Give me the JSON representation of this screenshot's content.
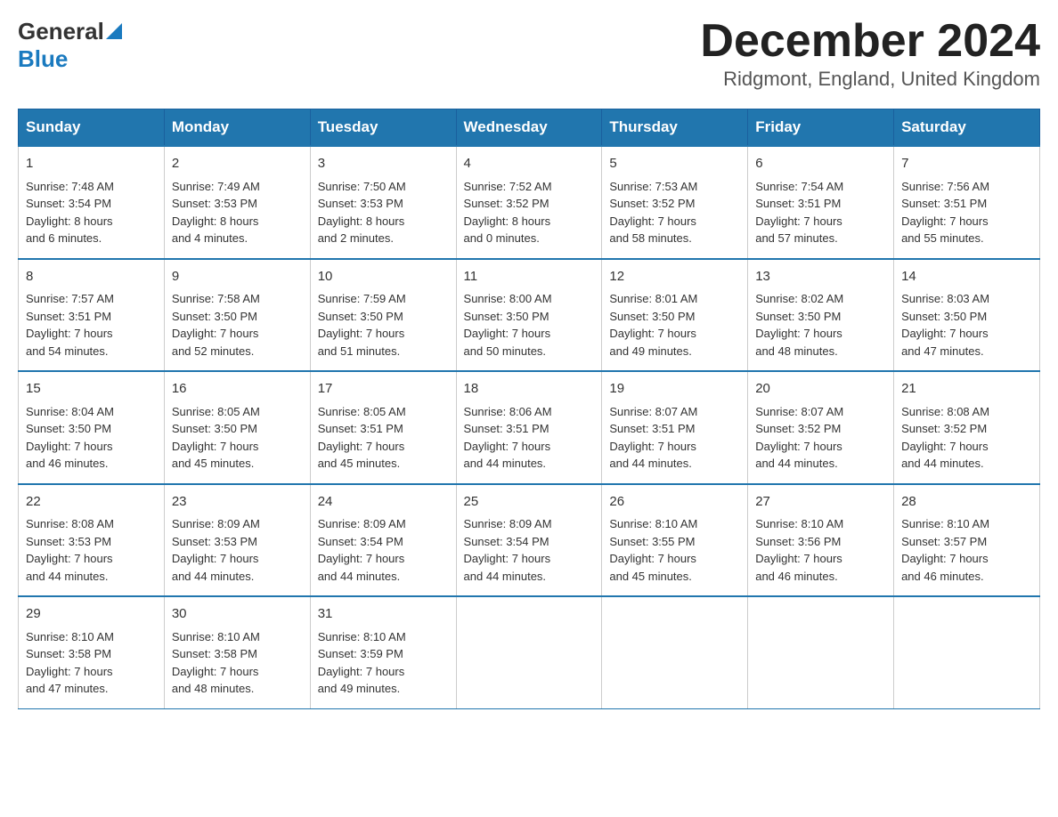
{
  "header": {
    "logo_general": "General",
    "logo_blue": "Blue",
    "month_title": "December 2024",
    "subtitle": "Ridgmont, England, United Kingdom"
  },
  "weekdays": [
    "Sunday",
    "Monday",
    "Tuesday",
    "Wednesday",
    "Thursday",
    "Friday",
    "Saturday"
  ],
  "weeks": [
    [
      {
        "day": "1",
        "sunrise": "7:48 AM",
        "sunset": "3:54 PM",
        "daylight": "8 hours and 6 minutes."
      },
      {
        "day": "2",
        "sunrise": "7:49 AM",
        "sunset": "3:53 PM",
        "daylight": "8 hours and 4 minutes."
      },
      {
        "day": "3",
        "sunrise": "7:50 AM",
        "sunset": "3:53 PM",
        "daylight": "8 hours and 2 minutes."
      },
      {
        "day": "4",
        "sunrise": "7:52 AM",
        "sunset": "3:52 PM",
        "daylight": "8 hours and 0 minutes."
      },
      {
        "day": "5",
        "sunrise": "7:53 AM",
        "sunset": "3:52 PM",
        "daylight": "7 hours and 58 minutes."
      },
      {
        "day": "6",
        "sunrise": "7:54 AM",
        "sunset": "3:51 PM",
        "daylight": "7 hours and 57 minutes."
      },
      {
        "day": "7",
        "sunrise": "7:56 AM",
        "sunset": "3:51 PM",
        "daylight": "7 hours and 55 minutes."
      }
    ],
    [
      {
        "day": "8",
        "sunrise": "7:57 AM",
        "sunset": "3:51 PM",
        "daylight": "7 hours and 54 minutes."
      },
      {
        "day": "9",
        "sunrise": "7:58 AM",
        "sunset": "3:50 PM",
        "daylight": "7 hours and 52 minutes."
      },
      {
        "day": "10",
        "sunrise": "7:59 AM",
        "sunset": "3:50 PM",
        "daylight": "7 hours and 51 minutes."
      },
      {
        "day": "11",
        "sunrise": "8:00 AM",
        "sunset": "3:50 PM",
        "daylight": "7 hours and 50 minutes."
      },
      {
        "day": "12",
        "sunrise": "8:01 AM",
        "sunset": "3:50 PM",
        "daylight": "7 hours and 49 minutes."
      },
      {
        "day": "13",
        "sunrise": "8:02 AM",
        "sunset": "3:50 PM",
        "daylight": "7 hours and 48 minutes."
      },
      {
        "day": "14",
        "sunrise": "8:03 AM",
        "sunset": "3:50 PM",
        "daylight": "7 hours and 47 minutes."
      }
    ],
    [
      {
        "day": "15",
        "sunrise": "8:04 AM",
        "sunset": "3:50 PM",
        "daylight": "7 hours and 46 minutes."
      },
      {
        "day": "16",
        "sunrise": "8:05 AM",
        "sunset": "3:50 PM",
        "daylight": "7 hours and 45 minutes."
      },
      {
        "day": "17",
        "sunrise": "8:05 AM",
        "sunset": "3:51 PM",
        "daylight": "7 hours and 45 minutes."
      },
      {
        "day": "18",
        "sunrise": "8:06 AM",
        "sunset": "3:51 PM",
        "daylight": "7 hours and 44 minutes."
      },
      {
        "day": "19",
        "sunrise": "8:07 AM",
        "sunset": "3:51 PM",
        "daylight": "7 hours and 44 minutes."
      },
      {
        "day": "20",
        "sunrise": "8:07 AM",
        "sunset": "3:52 PM",
        "daylight": "7 hours and 44 minutes."
      },
      {
        "day": "21",
        "sunrise": "8:08 AM",
        "sunset": "3:52 PM",
        "daylight": "7 hours and 44 minutes."
      }
    ],
    [
      {
        "day": "22",
        "sunrise": "8:08 AM",
        "sunset": "3:53 PM",
        "daylight": "7 hours and 44 minutes."
      },
      {
        "day": "23",
        "sunrise": "8:09 AM",
        "sunset": "3:53 PM",
        "daylight": "7 hours and 44 minutes."
      },
      {
        "day": "24",
        "sunrise": "8:09 AM",
        "sunset": "3:54 PM",
        "daylight": "7 hours and 44 minutes."
      },
      {
        "day": "25",
        "sunrise": "8:09 AM",
        "sunset": "3:54 PM",
        "daylight": "7 hours and 44 minutes."
      },
      {
        "day": "26",
        "sunrise": "8:10 AM",
        "sunset": "3:55 PM",
        "daylight": "7 hours and 45 minutes."
      },
      {
        "day": "27",
        "sunrise": "8:10 AM",
        "sunset": "3:56 PM",
        "daylight": "7 hours and 46 minutes."
      },
      {
        "day": "28",
        "sunrise": "8:10 AM",
        "sunset": "3:57 PM",
        "daylight": "7 hours and 46 minutes."
      }
    ],
    [
      {
        "day": "29",
        "sunrise": "8:10 AM",
        "sunset": "3:58 PM",
        "daylight": "7 hours and 47 minutes."
      },
      {
        "day": "30",
        "sunrise": "8:10 AM",
        "sunset": "3:58 PM",
        "daylight": "7 hours and 48 minutes."
      },
      {
        "day": "31",
        "sunrise": "8:10 AM",
        "sunset": "3:59 PM",
        "daylight": "7 hours and 49 minutes."
      },
      null,
      null,
      null,
      null
    ]
  ],
  "labels": {
    "sunrise": "Sunrise:",
    "sunset": "Sunset:",
    "daylight": "Daylight:"
  }
}
